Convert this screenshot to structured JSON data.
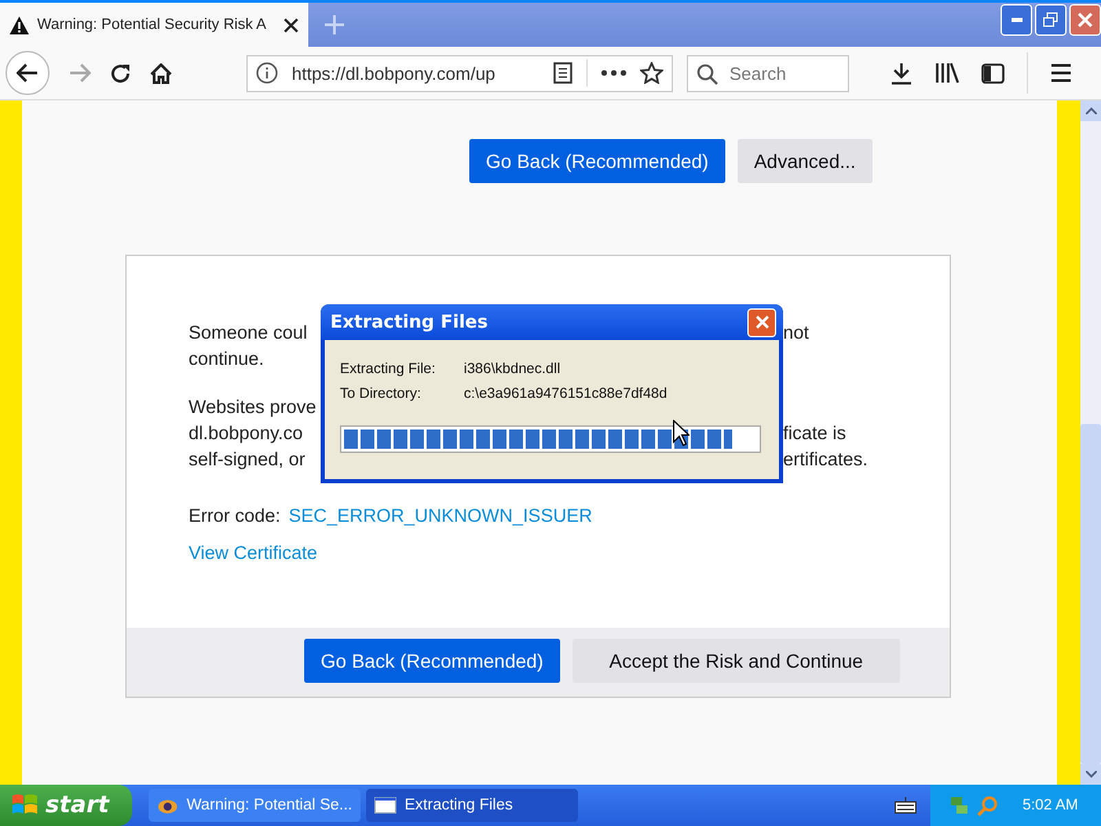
{
  "browser": {
    "tab": {
      "title": "Warning: Potential Security Risk A",
      "selected": true
    },
    "url": "https://dl.bobpony.com/up",
    "search": {
      "placeholder": "Search"
    }
  },
  "page": {
    "top_buttons": [
      {
        "label": "Go Back (Recommended)",
        "kind": "primary"
      },
      {
        "label": "Advanced...",
        "kind": "secondary"
      }
    ],
    "card": {
      "paragraphs": [
        [
          {
            "left": "Someone coul",
            "right": "not"
          },
          {
            "left": "continue."
          }
        ],
        [
          {
            "left": "Websites prove"
          },
          {
            "left": "dl.bobpony.co",
            "right": "ficate is"
          },
          {
            "left": "self-signed, or",
            "right": "ertificates."
          }
        ]
      ],
      "error_label": "Error code:",
      "error_code": "SEC_ERROR_UNKNOWN_ISSUER",
      "view_certificate": "View Certificate",
      "buttons": [
        {
          "label": "Go Back (Recommended)",
          "kind": "primary"
        },
        {
          "label": "Accept the Risk and Continue",
          "kind": "secondary"
        }
      ]
    }
  },
  "dialog": {
    "title": "Extracting Files",
    "fields": [
      {
        "label": "Extracting File:",
        "value": "i386\\kbdnec.dll"
      },
      {
        "label": "To Directory:",
        "value": "c:\\e3a961a9476151c88e7df48d"
      }
    ],
    "progress": {
      "level": 0.94
    }
  },
  "taskbar": {
    "start": "start",
    "tasks": [
      {
        "label": "Warning: Potential Se...",
        "selected": false
      },
      {
        "label": "Extracting Files",
        "selected": true
      }
    ],
    "clock": "5:02 AM"
  }
}
